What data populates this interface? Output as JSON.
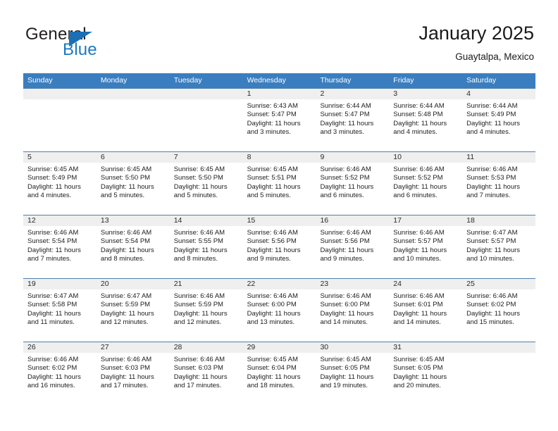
{
  "brand": {
    "name_top": "General",
    "name_bottom": "Blue"
  },
  "header": {
    "title": "January 2025",
    "subtitle": "Guaytalpa, Mexico"
  },
  "colors": {
    "header_blue": "#3a7ec0",
    "brand_blue": "#1c79c0",
    "date_band": "#efefef",
    "row_divider": "#4e7fae"
  },
  "weekdays": [
    "Sunday",
    "Monday",
    "Tuesday",
    "Wednesday",
    "Thursday",
    "Friday",
    "Saturday"
  ],
  "weeks": [
    [
      {
        "date": "",
        "sunrise": "",
        "sunset": "",
        "daylight1": "",
        "daylight2": ""
      },
      {
        "date": "",
        "sunrise": "",
        "sunset": "",
        "daylight1": "",
        "daylight2": ""
      },
      {
        "date": "",
        "sunrise": "",
        "sunset": "",
        "daylight1": "",
        "daylight2": ""
      },
      {
        "date": "1",
        "sunrise": "Sunrise: 6:43 AM",
        "sunset": "Sunset: 5:47 PM",
        "daylight1": "Daylight: 11 hours",
        "daylight2": "and 3 minutes."
      },
      {
        "date": "2",
        "sunrise": "Sunrise: 6:44 AM",
        "sunset": "Sunset: 5:47 PM",
        "daylight1": "Daylight: 11 hours",
        "daylight2": "and 3 minutes."
      },
      {
        "date": "3",
        "sunrise": "Sunrise: 6:44 AM",
        "sunset": "Sunset: 5:48 PM",
        "daylight1": "Daylight: 11 hours",
        "daylight2": "and 4 minutes."
      },
      {
        "date": "4",
        "sunrise": "Sunrise: 6:44 AM",
        "sunset": "Sunset: 5:49 PM",
        "daylight1": "Daylight: 11 hours",
        "daylight2": "and 4 minutes."
      }
    ],
    [
      {
        "date": "5",
        "sunrise": "Sunrise: 6:45 AM",
        "sunset": "Sunset: 5:49 PM",
        "daylight1": "Daylight: 11 hours",
        "daylight2": "and 4 minutes."
      },
      {
        "date": "6",
        "sunrise": "Sunrise: 6:45 AM",
        "sunset": "Sunset: 5:50 PM",
        "daylight1": "Daylight: 11 hours",
        "daylight2": "and 5 minutes."
      },
      {
        "date": "7",
        "sunrise": "Sunrise: 6:45 AM",
        "sunset": "Sunset: 5:50 PM",
        "daylight1": "Daylight: 11 hours",
        "daylight2": "and 5 minutes."
      },
      {
        "date": "8",
        "sunrise": "Sunrise: 6:45 AM",
        "sunset": "Sunset: 5:51 PM",
        "daylight1": "Daylight: 11 hours",
        "daylight2": "and 5 minutes."
      },
      {
        "date": "9",
        "sunrise": "Sunrise: 6:46 AM",
        "sunset": "Sunset: 5:52 PM",
        "daylight1": "Daylight: 11 hours",
        "daylight2": "and 6 minutes."
      },
      {
        "date": "10",
        "sunrise": "Sunrise: 6:46 AM",
        "sunset": "Sunset: 5:52 PM",
        "daylight1": "Daylight: 11 hours",
        "daylight2": "and 6 minutes."
      },
      {
        "date": "11",
        "sunrise": "Sunrise: 6:46 AM",
        "sunset": "Sunset: 5:53 PM",
        "daylight1": "Daylight: 11 hours",
        "daylight2": "and 7 minutes."
      }
    ],
    [
      {
        "date": "12",
        "sunrise": "Sunrise: 6:46 AM",
        "sunset": "Sunset: 5:54 PM",
        "daylight1": "Daylight: 11 hours",
        "daylight2": "and 7 minutes."
      },
      {
        "date": "13",
        "sunrise": "Sunrise: 6:46 AM",
        "sunset": "Sunset: 5:54 PM",
        "daylight1": "Daylight: 11 hours",
        "daylight2": "and 8 minutes."
      },
      {
        "date": "14",
        "sunrise": "Sunrise: 6:46 AM",
        "sunset": "Sunset: 5:55 PM",
        "daylight1": "Daylight: 11 hours",
        "daylight2": "and 8 minutes."
      },
      {
        "date": "15",
        "sunrise": "Sunrise: 6:46 AM",
        "sunset": "Sunset: 5:56 PM",
        "daylight1": "Daylight: 11 hours",
        "daylight2": "and 9 minutes."
      },
      {
        "date": "16",
        "sunrise": "Sunrise: 6:46 AM",
        "sunset": "Sunset: 5:56 PM",
        "daylight1": "Daylight: 11 hours",
        "daylight2": "and 9 minutes."
      },
      {
        "date": "17",
        "sunrise": "Sunrise: 6:46 AM",
        "sunset": "Sunset: 5:57 PM",
        "daylight1": "Daylight: 11 hours",
        "daylight2": "and 10 minutes."
      },
      {
        "date": "18",
        "sunrise": "Sunrise: 6:47 AM",
        "sunset": "Sunset: 5:57 PM",
        "daylight1": "Daylight: 11 hours",
        "daylight2": "and 10 minutes."
      }
    ],
    [
      {
        "date": "19",
        "sunrise": "Sunrise: 6:47 AM",
        "sunset": "Sunset: 5:58 PM",
        "daylight1": "Daylight: 11 hours",
        "daylight2": "and 11 minutes."
      },
      {
        "date": "20",
        "sunrise": "Sunrise: 6:47 AM",
        "sunset": "Sunset: 5:59 PM",
        "daylight1": "Daylight: 11 hours",
        "daylight2": "and 12 minutes."
      },
      {
        "date": "21",
        "sunrise": "Sunrise: 6:46 AM",
        "sunset": "Sunset: 5:59 PM",
        "daylight1": "Daylight: 11 hours",
        "daylight2": "and 12 minutes."
      },
      {
        "date": "22",
        "sunrise": "Sunrise: 6:46 AM",
        "sunset": "Sunset: 6:00 PM",
        "daylight1": "Daylight: 11 hours",
        "daylight2": "and 13 minutes."
      },
      {
        "date": "23",
        "sunrise": "Sunrise: 6:46 AM",
        "sunset": "Sunset: 6:00 PM",
        "daylight1": "Daylight: 11 hours",
        "daylight2": "and 14 minutes."
      },
      {
        "date": "24",
        "sunrise": "Sunrise: 6:46 AM",
        "sunset": "Sunset: 6:01 PM",
        "daylight1": "Daylight: 11 hours",
        "daylight2": "and 14 minutes."
      },
      {
        "date": "25",
        "sunrise": "Sunrise: 6:46 AM",
        "sunset": "Sunset: 6:02 PM",
        "daylight1": "Daylight: 11 hours",
        "daylight2": "and 15 minutes."
      }
    ],
    [
      {
        "date": "26",
        "sunrise": "Sunrise: 6:46 AM",
        "sunset": "Sunset: 6:02 PM",
        "daylight1": "Daylight: 11 hours",
        "daylight2": "and 16 minutes."
      },
      {
        "date": "27",
        "sunrise": "Sunrise: 6:46 AM",
        "sunset": "Sunset: 6:03 PM",
        "daylight1": "Daylight: 11 hours",
        "daylight2": "and 17 minutes."
      },
      {
        "date": "28",
        "sunrise": "Sunrise: 6:46 AM",
        "sunset": "Sunset: 6:03 PM",
        "daylight1": "Daylight: 11 hours",
        "daylight2": "and 17 minutes."
      },
      {
        "date": "29",
        "sunrise": "Sunrise: 6:45 AM",
        "sunset": "Sunset: 6:04 PM",
        "daylight1": "Daylight: 11 hours",
        "daylight2": "and 18 minutes."
      },
      {
        "date": "30",
        "sunrise": "Sunrise: 6:45 AM",
        "sunset": "Sunset: 6:05 PM",
        "daylight1": "Daylight: 11 hours",
        "daylight2": "and 19 minutes."
      },
      {
        "date": "31",
        "sunrise": "Sunrise: 6:45 AM",
        "sunset": "Sunset: 6:05 PM",
        "daylight1": "Daylight: 11 hours",
        "daylight2": "and 20 minutes."
      },
      {
        "date": "",
        "sunrise": "",
        "sunset": "",
        "daylight1": "",
        "daylight2": ""
      }
    ]
  ]
}
